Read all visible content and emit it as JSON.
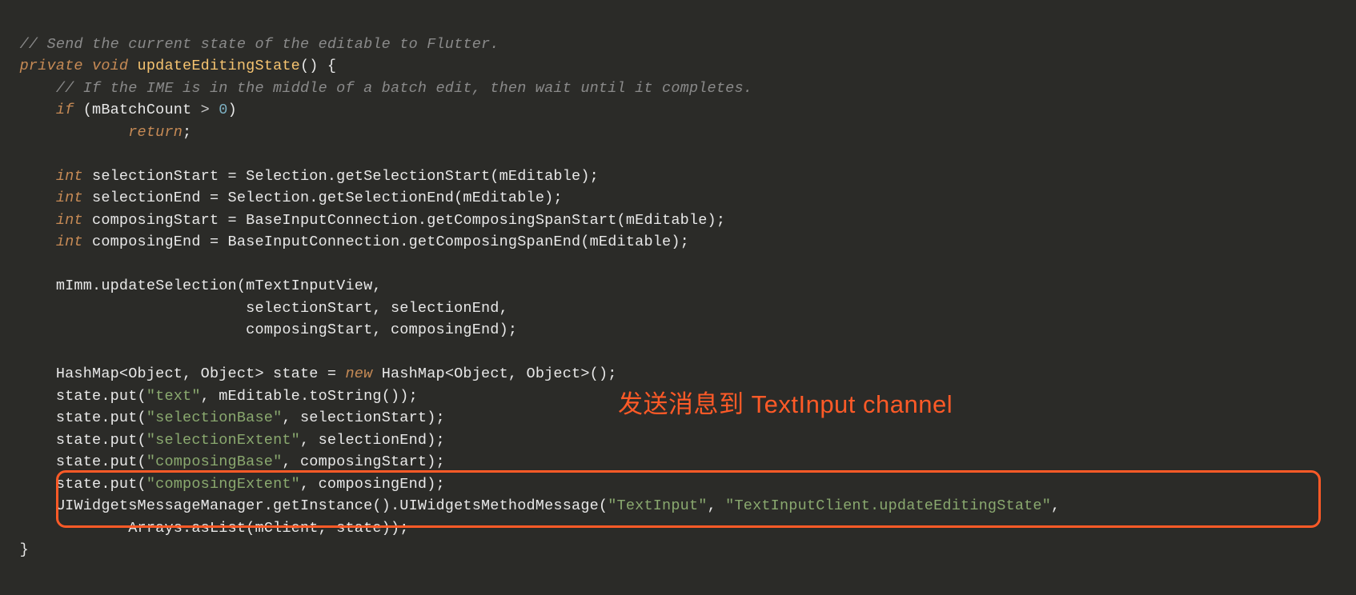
{
  "code": {
    "l1": "// Send the current state of the editable to Flutter.",
    "l2k": "private void ",
    "l2m": "updateEditingState",
    "l2e": "() {",
    "l3": "    // If the IME is in the middle of a batch edit, then wait until it completes.",
    "l4k": "    if ",
    "l4a": "(mBatchCount ",
    "l4op": "> ",
    "l4n": "0",
    "l4e": ")",
    "l5k": "            return",
    "l5e": ";",
    "l7k": "    int ",
    "l7a": "selectionStart = Selection.getSelectionStart(mEditable);",
    "l8k": "    int ",
    "l8a": "selectionEnd = Selection.getSelectionEnd(mEditable);",
    "l9k": "    int ",
    "l9a": "composingStart = BaseInputConnection.getComposingSpanStart(mEditable);",
    "l10k": "    int ",
    "l10a": "composingEnd = BaseInputConnection.getComposingSpanEnd(mEditable);",
    "l12": "    mImm.updateSelection(mTextInputView,",
    "l13": "                         selectionStart, selectionEnd,",
    "l14": "                         composingStart, composingEnd);",
    "l16a": "    HashMap<Object, Object> state = ",
    "l16k": "new ",
    "l16b": "HashMap<Object, Object>();",
    "l17a": "    state.put(",
    "l17s": "\"text\"",
    "l17b": ", mEditable.toString());",
    "l18a": "    state.put(",
    "l18s": "\"selectionBase\"",
    "l18b": ", selectionStart);",
    "l19a": "    state.put(",
    "l19s": "\"selectionExtent\"",
    "l19b": ", selectionEnd);",
    "l20a": "    state.put(",
    "l20s": "\"composingBase\"",
    "l20b": ", composingStart);",
    "l21a": "    state.put(",
    "l21s": "\"composingExtent\"",
    "l21b": ", composingEnd);",
    "l22a": "    UIWidgetsMessageManager.getInstance().UIWidgetsMethodMessage(",
    "l22s1": "\"TextInput\"",
    "l22m": ", ",
    "l22s2": "\"TextInputClient.updateEditingState\"",
    "l22e": ",",
    "l23": "            Arrays.asList(mClient, state));",
    "l24": "}"
  },
  "annotation": "发送消息到 TextInput channel",
  "colors": {
    "background": "#2b2b28",
    "highlight": "#ff5a27",
    "comment": "#8a8a8a",
    "keyword": "#c68a55",
    "string": "#8aa96f",
    "method": "#f5c370",
    "number": "#7db0c2"
  }
}
